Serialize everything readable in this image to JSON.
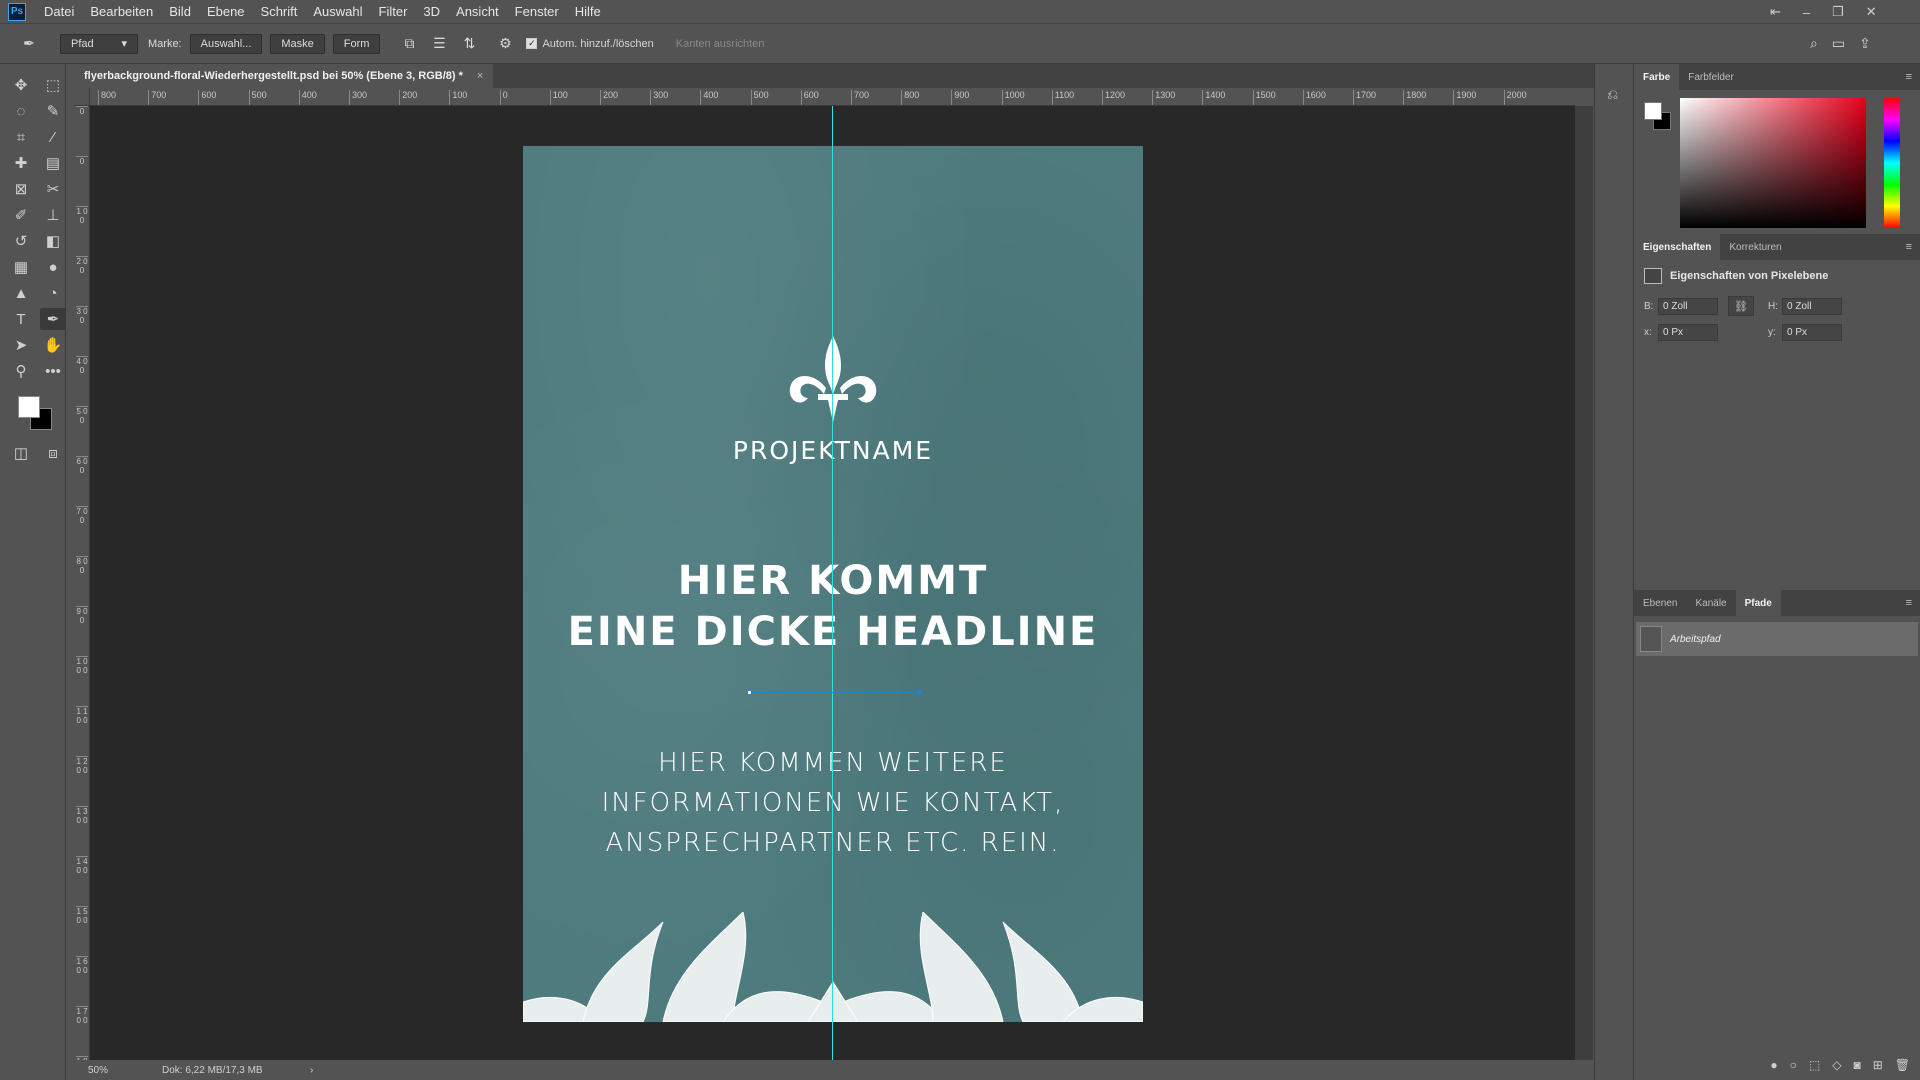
{
  "menu": {
    "logo": "Ps",
    "items": [
      "Datei",
      "Bearbeiten",
      "Bild",
      "Ebene",
      "Schrift",
      "Auswahl",
      "Filter",
      "3D",
      "Ansicht",
      "Fenster",
      "Hilfe"
    ]
  },
  "options": {
    "tool_mode": "Pfad",
    "marke_label": "Marke:",
    "auswahl_btn": "Auswahl...",
    "maske_btn": "Maske",
    "form_btn": "Form",
    "autom_checkbox": "Autom. hinzuf./löschen",
    "kanten_label": "Kanten ausrichten"
  },
  "document": {
    "tab_title": "flyerbackground-floral-Wiederhergestellt.psd bei 50% (Ebene 3, RGB/8) *",
    "close": "×"
  },
  "ruler": {
    "top_labels": [
      "800",
      "700",
      "600",
      "500",
      "400",
      "300",
      "200",
      "100",
      "0",
      "100",
      "200",
      "300",
      "400",
      "500",
      "600",
      "700",
      "800",
      "900",
      "1000",
      "1100",
      "1200",
      "1300",
      "1400",
      "1500",
      "1600",
      "1700",
      "1800",
      "1900",
      "2000"
    ],
    "left_labels": [
      "0",
      "0",
      "1 0 0",
      "2 0 0",
      "3 0 0",
      "4 0 0",
      "5 0 0",
      "6 0 0",
      "7 0 0",
      "8 0 0",
      "9 0 0",
      "1 0 0 0",
      "1 1 0 0",
      "1 2 0 0",
      "1 3 0 0",
      "1 4 0 0",
      "1 5 0 0",
      "1 6 0 0",
      "1 7 0 0",
      "1 8 0 0"
    ]
  },
  "flyer": {
    "projektname": "PROJEKTNAME",
    "headline_1": "HIER KOMMT",
    "headline_2": "EINE DICKE HEADLINE",
    "info_1": "HIER KOMMEN WEITERE",
    "info_2": "INFORMATIONEN WIE KONTAKT,",
    "info_3": "ANSPRECHPARTNER ETC. REIN.",
    "background_color": "#4e7b7e"
  },
  "status": {
    "zoom": "50%",
    "doc_size": "Dok: 6,22 MB/17,3 MB",
    "arrow": "›"
  },
  "panels": {
    "color_tabs": [
      "Farbe",
      "Farbfelder"
    ],
    "props_tabs": [
      "Eigenschaften",
      "Korrekturen"
    ],
    "props_title": "Eigenschaften von Pixelebene",
    "b_label": "B:",
    "b_value": "0 Zoll",
    "h_label": "H:",
    "h_value": "0 Zoll",
    "x_label": "x:",
    "x_value": "0 Px",
    "y_label": "y:",
    "y_value": "0 Px",
    "layer_tabs": [
      "Ebenen",
      "Kanäle",
      "Pfade"
    ],
    "path_name": "Arbeitspfad"
  },
  "colors": {
    "guide": "#2fe0e0",
    "path": "#2f7fbf",
    "accent": "#31a8ff"
  }
}
